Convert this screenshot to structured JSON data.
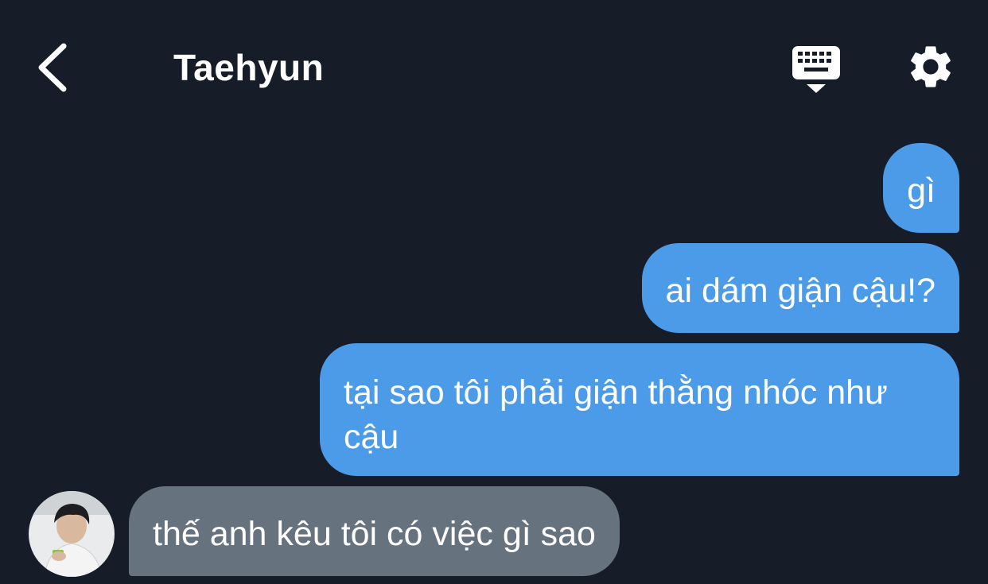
{
  "header": {
    "title": "Taehyun",
    "back_icon": "chevron-left-icon",
    "keyboard_icon": "keyboard-hide-icon",
    "settings_icon": "gear-icon"
  },
  "messages": [
    {
      "direction": "outgoing",
      "text": "gì"
    },
    {
      "direction": "outgoing",
      "text": "ai dám giận cậu!?"
    },
    {
      "direction": "outgoing",
      "text": "tại sao tôi phải giận thằng nhóc như cậu"
    },
    {
      "direction": "incoming",
      "text": "thế anh kêu tôi có việc gì sao"
    }
  ],
  "colors": {
    "background": "#161d29",
    "outgoing_bubble": "#4b9be8",
    "incoming_bubble": "#67727f"
  }
}
